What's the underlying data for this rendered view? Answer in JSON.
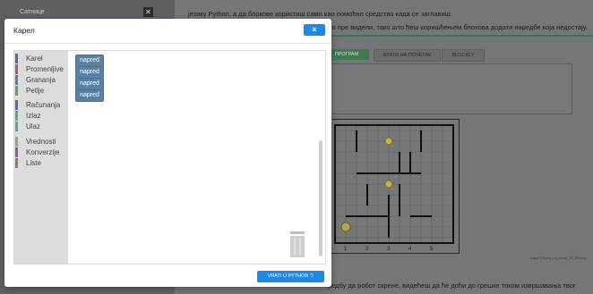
{
  "background": {
    "nav_item": "Сатнице",
    "close_glyph": "✕",
    "text_line1": "језику Python, а да блокове користиш само као помоћно средство када се заглавиш.",
    "text_line2": "ло пре видели, тако што ћеш коришћењем блохова додати наредбе која недостају.",
    "buttons": {
      "run": "ПРОГРАМ",
      "reset": "ВРАТИ НА ПОЧЕТАК",
      "blockly": "BLOCKLY"
    },
    "board_axis_labels": [
      "1",
      "2",
      "3",
      "4",
      "5"
    ],
    "board_caption": "Karel 3 Karel_na_trima_10_Blockly",
    "text_bottom": "редбу да робот скрене, видећеш да ће доћи до грешке током извршавања твог"
  },
  "modal": {
    "title": "Карел",
    "close_label": "×",
    "categories": [
      {
        "label": "Karel",
        "color": "#5b67a5"
      },
      {
        "label": "Promenljive",
        "color": "#a55b80"
      },
      {
        "label": "Grananja",
        "color": "#5b80a5"
      },
      {
        "label": "Petlje",
        "color": "#5ba55b"
      },
      {
        "label": "Računanja",
        "color": "#5b67a5"
      },
      {
        "label": "Izlaz",
        "color": "#5ba58c"
      },
      {
        "label": "Ulaz",
        "color": "#5ba5a5"
      },
      {
        "label": "Vrednosti",
        "color": "#a5a55b"
      },
      {
        "label": "Konverzije",
        "color": "#8c5ba5"
      },
      {
        "label": "Liste",
        "color": "#a5745b"
      }
    ],
    "blocks": [
      "napred",
      "napred",
      "napred",
      "napred"
    ],
    "trash_icon": "trash-icon",
    "footer_button": "VRATI U PYTHON ⮌"
  }
}
